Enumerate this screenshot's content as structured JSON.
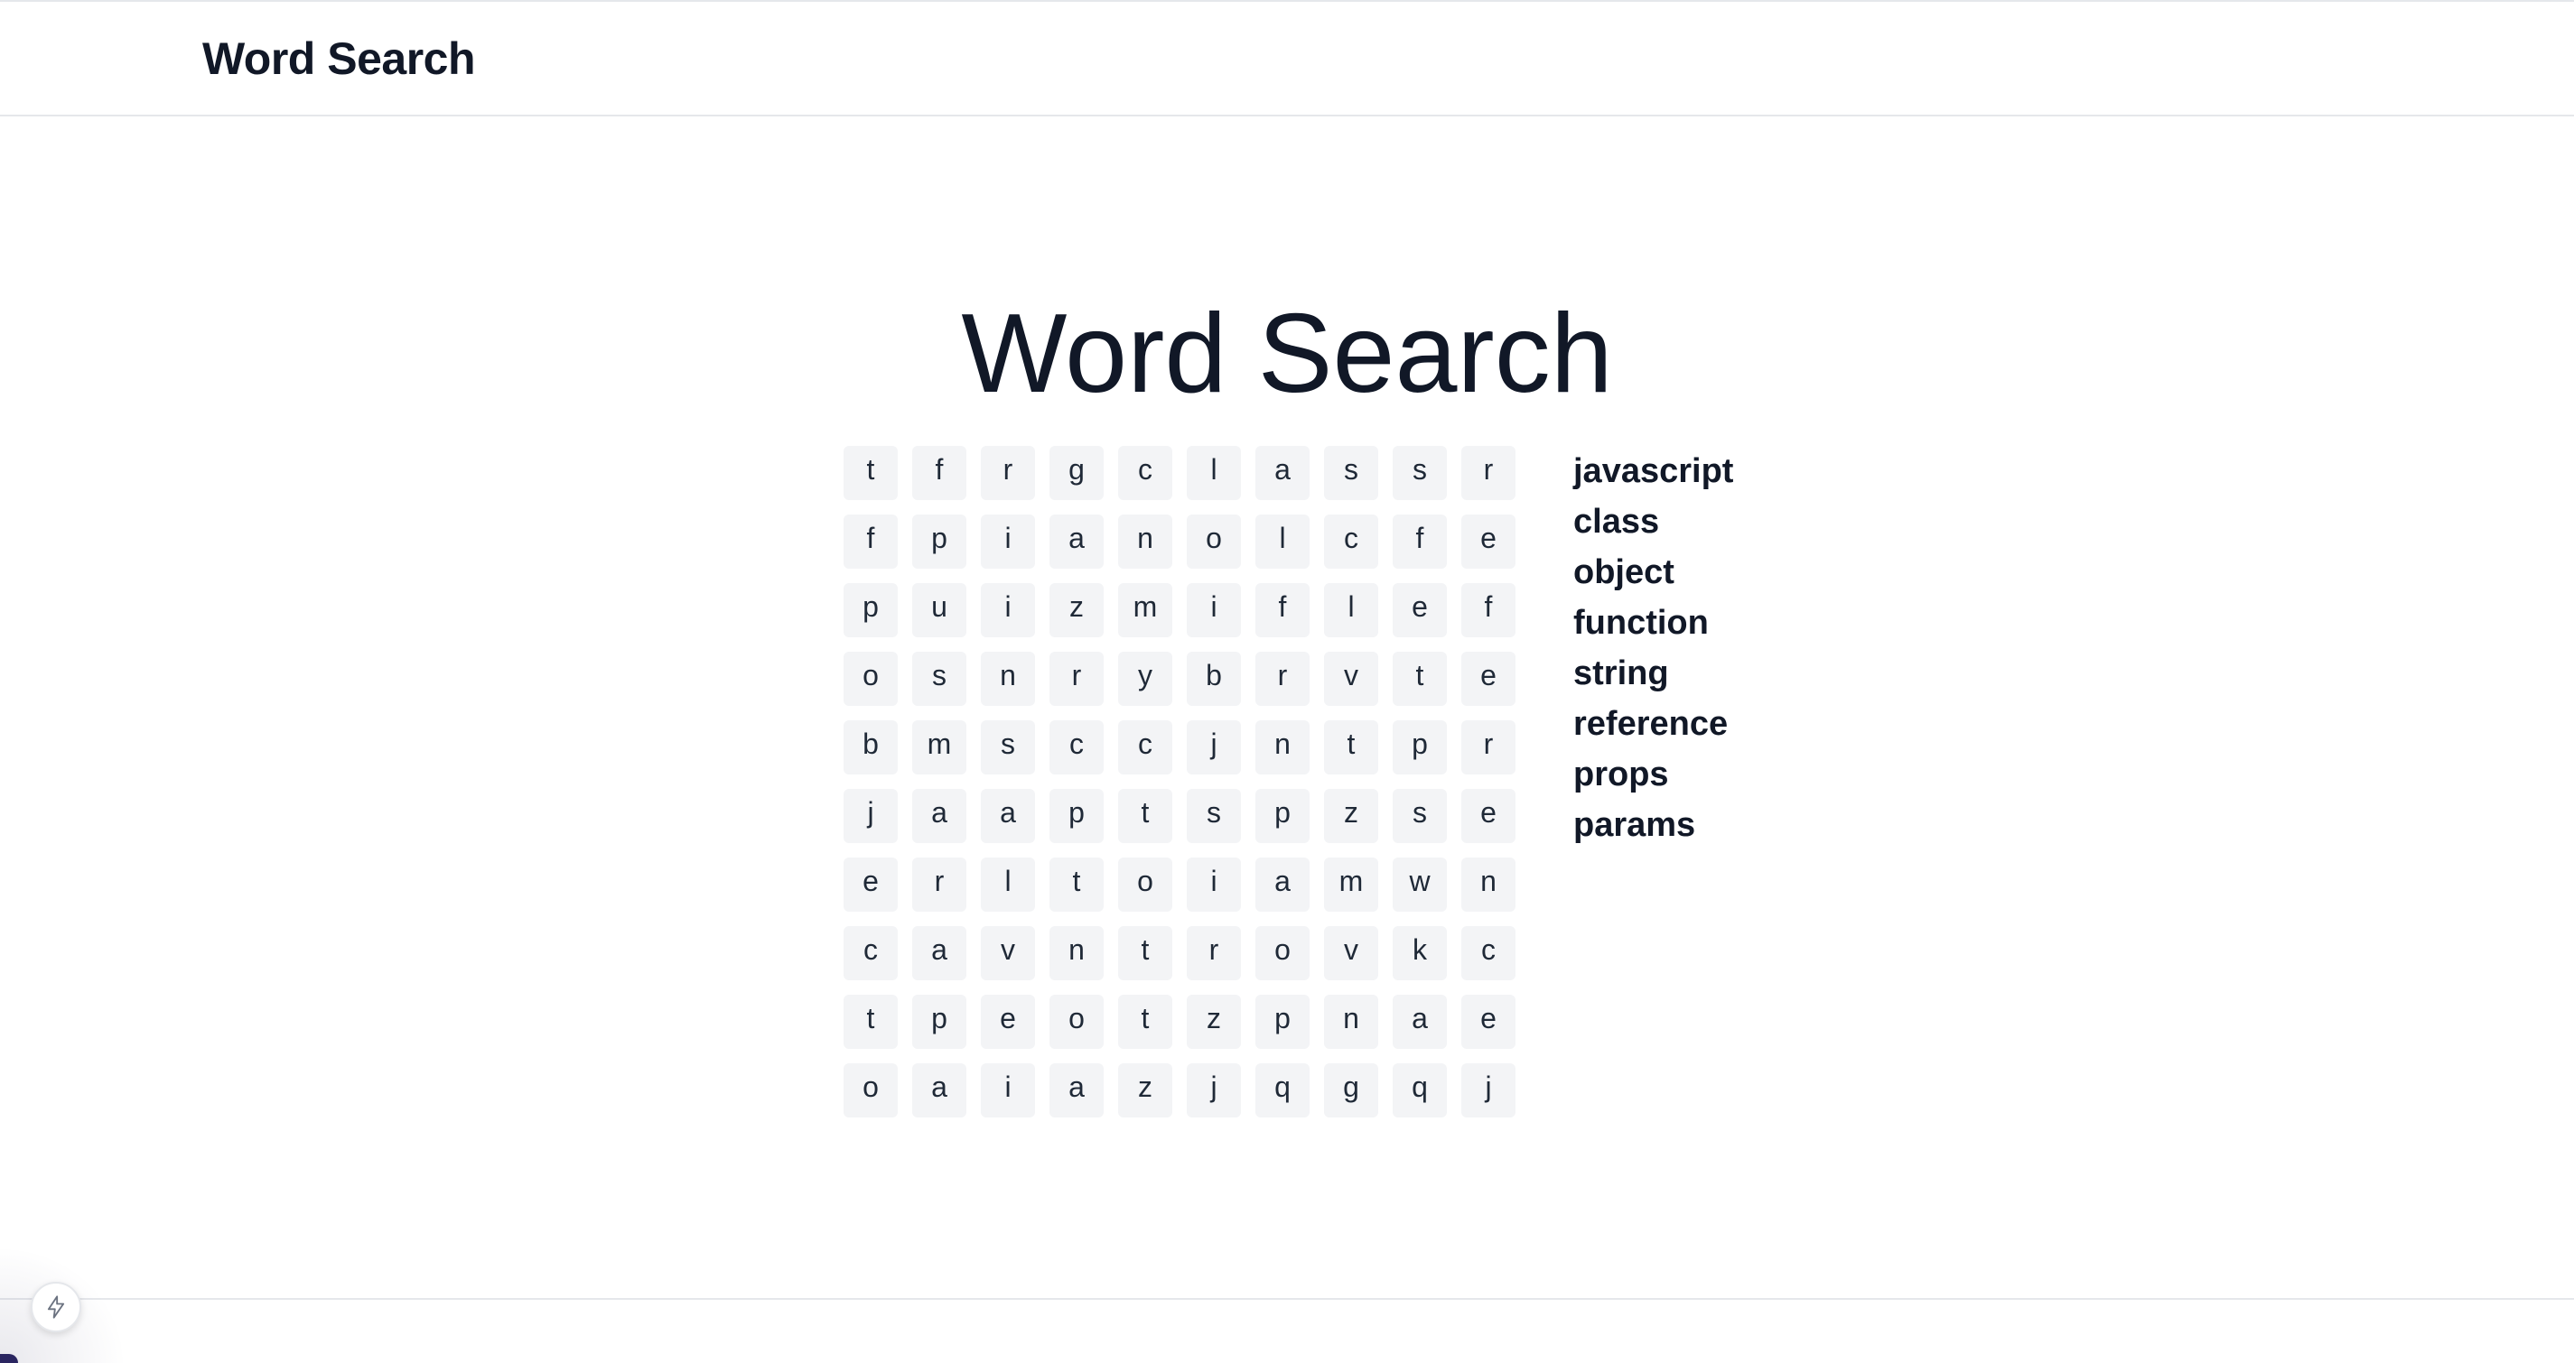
{
  "header": {
    "title": "Word Search"
  },
  "main": {
    "title": "Word Search"
  },
  "grid": {
    "rows": [
      [
        "t",
        "f",
        "r",
        "g",
        "c",
        "l",
        "a",
        "s",
        "s",
        "r"
      ],
      [
        "f",
        "p",
        "i",
        "a",
        "n",
        "o",
        "l",
        "c",
        "f",
        "e"
      ],
      [
        "p",
        "u",
        "i",
        "z",
        "m",
        "i",
        "f",
        "l",
        "e",
        "f"
      ],
      [
        "o",
        "s",
        "n",
        "r",
        "y",
        "b",
        "r",
        "v",
        "t",
        "e"
      ],
      [
        "b",
        "m",
        "s",
        "c",
        "c",
        "j",
        "n",
        "t",
        "p",
        "r"
      ],
      [
        "j",
        "a",
        "a",
        "p",
        "t",
        "s",
        "p",
        "z",
        "s",
        "e"
      ],
      [
        "e",
        "r",
        "l",
        "t",
        "o",
        "i",
        "a",
        "m",
        "w",
        "n"
      ],
      [
        "c",
        "a",
        "v",
        "n",
        "t",
        "r",
        "o",
        "v",
        "k",
        "c"
      ],
      [
        "t",
        "p",
        "e",
        "o",
        "t",
        "z",
        "p",
        "n",
        "a",
        "e"
      ],
      [
        "o",
        "a",
        "i",
        "a",
        "z",
        "j",
        "q",
        "g",
        "q",
        "j"
      ]
    ]
  },
  "words": [
    "javascript",
    "class",
    "object",
    "function",
    "string",
    "reference",
    "props",
    "params"
  ],
  "dev_indicator": {
    "icon": "lightning-bolt-icon"
  },
  "colors": {
    "text": "#111827",
    "cell_bg": "#f3f4f6",
    "border": "#e5e7eb"
  }
}
